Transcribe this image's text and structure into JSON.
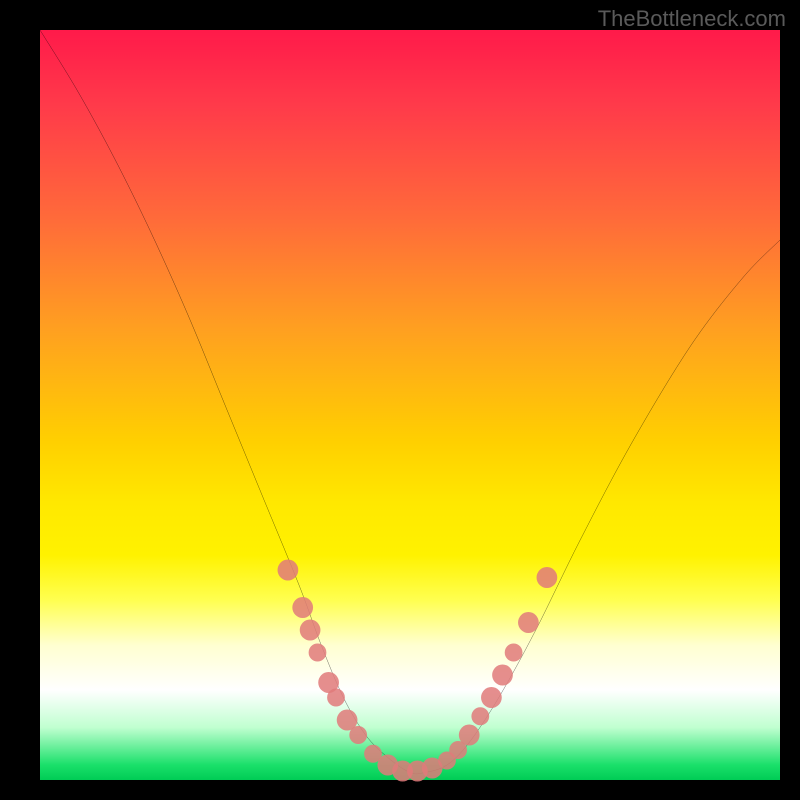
{
  "watermark": "TheBottleneck.com",
  "chart_data": {
    "type": "line",
    "title": "",
    "xlabel": "",
    "ylabel": "",
    "xlim": [
      0,
      100
    ],
    "ylim": [
      0,
      100
    ],
    "series": [
      {
        "name": "bottleneck-curve",
        "x": [
          0,
          5,
          10,
          15,
          20,
          25,
          30,
          35,
          38,
          41,
          44,
          47,
          50,
          52,
          55,
          58,
          62,
          67,
          73,
          80,
          88,
          95,
          100
        ],
        "y": [
          100,
          92,
          83,
          73,
          62,
          50,
          38,
          26,
          18,
          11,
          6,
          3,
          1,
          1,
          2,
          5,
          11,
          20,
          32,
          45,
          58,
          67,
          72
        ]
      }
    ],
    "markers": [
      {
        "x": 33.5,
        "y": 28,
        "r": 1.4
      },
      {
        "x": 35.5,
        "y": 23,
        "r": 1.4
      },
      {
        "x": 36.5,
        "y": 20,
        "r": 1.4
      },
      {
        "x": 37.5,
        "y": 17,
        "r": 1.2
      },
      {
        "x": 39.0,
        "y": 13,
        "r": 1.4
      },
      {
        "x": 40.0,
        "y": 11,
        "r": 1.2
      },
      {
        "x": 41.5,
        "y": 8,
        "r": 1.4
      },
      {
        "x": 43.0,
        "y": 6,
        "r": 1.2
      },
      {
        "x": 45.0,
        "y": 3.5,
        "r": 1.2
      },
      {
        "x": 47.0,
        "y": 2,
        "r": 1.4
      },
      {
        "x": 49.0,
        "y": 1.2,
        "r": 1.4
      },
      {
        "x": 51.0,
        "y": 1.2,
        "r": 1.4
      },
      {
        "x": 53.0,
        "y": 1.6,
        "r": 1.4
      },
      {
        "x": 55.0,
        "y": 2.6,
        "r": 1.2
      },
      {
        "x": 56.5,
        "y": 4,
        "r": 1.2
      },
      {
        "x": 58.0,
        "y": 6,
        "r": 1.4
      },
      {
        "x": 59.5,
        "y": 8.5,
        "r": 1.2
      },
      {
        "x": 61.0,
        "y": 11,
        "r": 1.4
      },
      {
        "x": 62.5,
        "y": 14,
        "r": 1.4
      },
      {
        "x": 64.0,
        "y": 17,
        "r": 1.2
      },
      {
        "x": 66.0,
        "y": 21,
        "r": 1.4
      },
      {
        "x": 68.5,
        "y": 27,
        "r": 1.4
      }
    ],
    "gradient_stops": [
      {
        "pos": 0,
        "color": "#ff1a4a"
      },
      {
        "pos": 55,
        "color": "#ffd000"
      },
      {
        "pos": 88,
        "color": "#ffffff"
      },
      {
        "pos": 100,
        "color": "#00cc55"
      }
    ]
  }
}
